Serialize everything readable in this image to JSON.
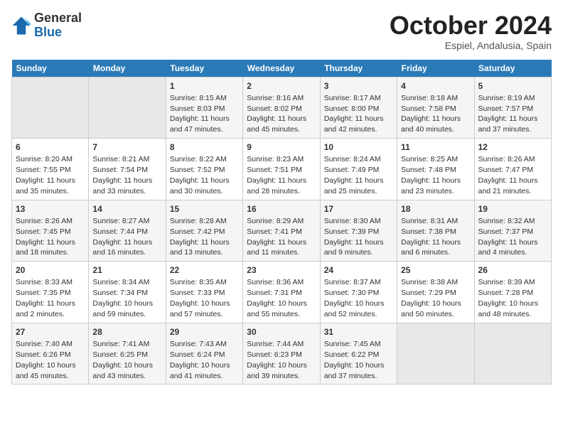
{
  "logo": {
    "general": "General",
    "blue": "Blue"
  },
  "title": "October 2024",
  "subtitle": "Espiel, Andalusia, Spain",
  "days_header": [
    "Sunday",
    "Monday",
    "Tuesday",
    "Wednesday",
    "Thursday",
    "Friday",
    "Saturday"
  ],
  "weeks": [
    [
      {
        "day": "",
        "sunrise": "",
        "sunset": "",
        "daylight": ""
      },
      {
        "day": "",
        "sunrise": "",
        "sunset": "",
        "daylight": ""
      },
      {
        "day": "1",
        "sunrise": "Sunrise: 8:15 AM",
        "sunset": "Sunset: 8:03 PM",
        "daylight": "Daylight: 11 hours and 47 minutes."
      },
      {
        "day": "2",
        "sunrise": "Sunrise: 8:16 AM",
        "sunset": "Sunset: 8:02 PM",
        "daylight": "Daylight: 11 hours and 45 minutes."
      },
      {
        "day": "3",
        "sunrise": "Sunrise: 8:17 AM",
        "sunset": "Sunset: 8:00 PM",
        "daylight": "Daylight: 11 hours and 42 minutes."
      },
      {
        "day": "4",
        "sunrise": "Sunrise: 8:18 AM",
        "sunset": "Sunset: 7:58 PM",
        "daylight": "Daylight: 11 hours and 40 minutes."
      },
      {
        "day": "5",
        "sunrise": "Sunrise: 8:19 AM",
        "sunset": "Sunset: 7:57 PM",
        "daylight": "Daylight: 11 hours and 37 minutes."
      }
    ],
    [
      {
        "day": "6",
        "sunrise": "Sunrise: 8:20 AM",
        "sunset": "Sunset: 7:55 PM",
        "daylight": "Daylight: 11 hours and 35 minutes."
      },
      {
        "day": "7",
        "sunrise": "Sunrise: 8:21 AM",
        "sunset": "Sunset: 7:54 PM",
        "daylight": "Daylight: 11 hours and 33 minutes."
      },
      {
        "day": "8",
        "sunrise": "Sunrise: 8:22 AM",
        "sunset": "Sunset: 7:52 PM",
        "daylight": "Daylight: 11 hours and 30 minutes."
      },
      {
        "day": "9",
        "sunrise": "Sunrise: 8:23 AM",
        "sunset": "Sunset: 7:51 PM",
        "daylight": "Daylight: 11 hours and 28 minutes."
      },
      {
        "day": "10",
        "sunrise": "Sunrise: 8:24 AM",
        "sunset": "Sunset: 7:49 PM",
        "daylight": "Daylight: 11 hours and 25 minutes."
      },
      {
        "day": "11",
        "sunrise": "Sunrise: 8:25 AM",
        "sunset": "Sunset: 7:48 PM",
        "daylight": "Daylight: 11 hours and 23 minutes."
      },
      {
        "day": "12",
        "sunrise": "Sunrise: 8:26 AM",
        "sunset": "Sunset: 7:47 PM",
        "daylight": "Daylight: 11 hours and 21 minutes."
      }
    ],
    [
      {
        "day": "13",
        "sunrise": "Sunrise: 8:26 AM",
        "sunset": "Sunset: 7:45 PM",
        "daylight": "Daylight: 11 hours and 18 minutes."
      },
      {
        "day": "14",
        "sunrise": "Sunrise: 8:27 AM",
        "sunset": "Sunset: 7:44 PM",
        "daylight": "Daylight: 11 hours and 16 minutes."
      },
      {
        "day": "15",
        "sunrise": "Sunrise: 8:28 AM",
        "sunset": "Sunset: 7:42 PM",
        "daylight": "Daylight: 11 hours and 13 minutes."
      },
      {
        "day": "16",
        "sunrise": "Sunrise: 8:29 AM",
        "sunset": "Sunset: 7:41 PM",
        "daylight": "Daylight: 11 hours and 11 minutes."
      },
      {
        "day": "17",
        "sunrise": "Sunrise: 8:30 AM",
        "sunset": "Sunset: 7:39 PM",
        "daylight": "Daylight: 11 hours and 9 minutes."
      },
      {
        "day": "18",
        "sunrise": "Sunrise: 8:31 AM",
        "sunset": "Sunset: 7:38 PM",
        "daylight": "Daylight: 11 hours and 6 minutes."
      },
      {
        "day": "19",
        "sunrise": "Sunrise: 8:32 AM",
        "sunset": "Sunset: 7:37 PM",
        "daylight": "Daylight: 11 hours and 4 minutes."
      }
    ],
    [
      {
        "day": "20",
        "sunrise": "Sunrise: 8:33 AM",
        "sunset": "Sunset: 7:35 PM",
        "daylight": "Daylight: 11 hours and 2 minutes."
      },
      {
        "day": "21",
        "sunrise": "Sunrise: 8:34 AM",
        "sunset": "Sunset: 7:34 PM",
        "daylight": "Daylight: 10 hours and 59 minutes."
      },
      {
        "day": "22",
        "sunrise": "Sunrise: 8:35 AM",
        "sunset": "Sunset: 7:33 PM",
        "daylight": "Daylight: 10 hours and 57 minutes."
      },
      {
        "day": "23",
        "sunrise": "Sunrise: 8:36 AM",
        "sunset": "Sunset: 7:31 PM",
        "daylight": "Daylight: 10 hours and 55 minutes."
      },
      {
        "day": "24",
        "sunrise": "Sunrise: 8:37 AM",
        "sunset": "Sunset: 7:30 PM",
        "daylight": "Daylight: 10 hours and 52 minutes."
      },
      {
        "day": "25",
        "sunrise": "Sunrise: 8:38 AM",
        "sunset": "Sunset: 7:29 PM",
        "daylight": "Daylight: 10 hours and 50 minutes."
      },
      {
        "day": "26",
        "sunrise": "Sunrise: 8:39 AM",
        "sunset": "Sunset: 7:28 PM",
        "daylight": "Daylight: 10 hours and 48 minutes."
      }
    ],
    [
      {
        "day": "27",
        "sunrise": "Sunrise: 7:40 AM",
        "sunset": "Sunset: 6:26 PM",
        "daylight": "Daylight: 10 hours and 45 minutes."
      },
      {
        "day": "28",
        "sunrise": "Sunrise: 7:41 AM",
        "sunset": "Sunset: 6:25 PM",
        "daylight": "Daylight: 10 hours and 43 minutes."
      },
      {
        "day": "29",
        "sunrise": "Sunrise: 7:43 AM",
        "sunset": "Sunset: 6:24 PM",
        "daylight": "Daylight: 10 hours and 41 minutes."
      },
      {
        "day": "30",
        "sunrise": "Sunrise: 7:44 AM",
        "sunset": "Sunset: 6:23 PM",
        "daylight": "Daylight: 10 hours and 39 minutes."
      },
      {
        "day": "31",
        "sunrise": "Sunrise: 7:45 AM",
        "sunset": "Sunset: 6:22 PM",
        "daylight": "Daylight: 10 hours and 37 minutes."
      },
      {
        "day": "",
        "sunrise": "",
        "sunset": "",
        "daylight": ""
      },
      {
        "day": "",
        "sunrise": "",
        "sunset": "",
        "daylight": ""
      }
    ]
  ]
}
